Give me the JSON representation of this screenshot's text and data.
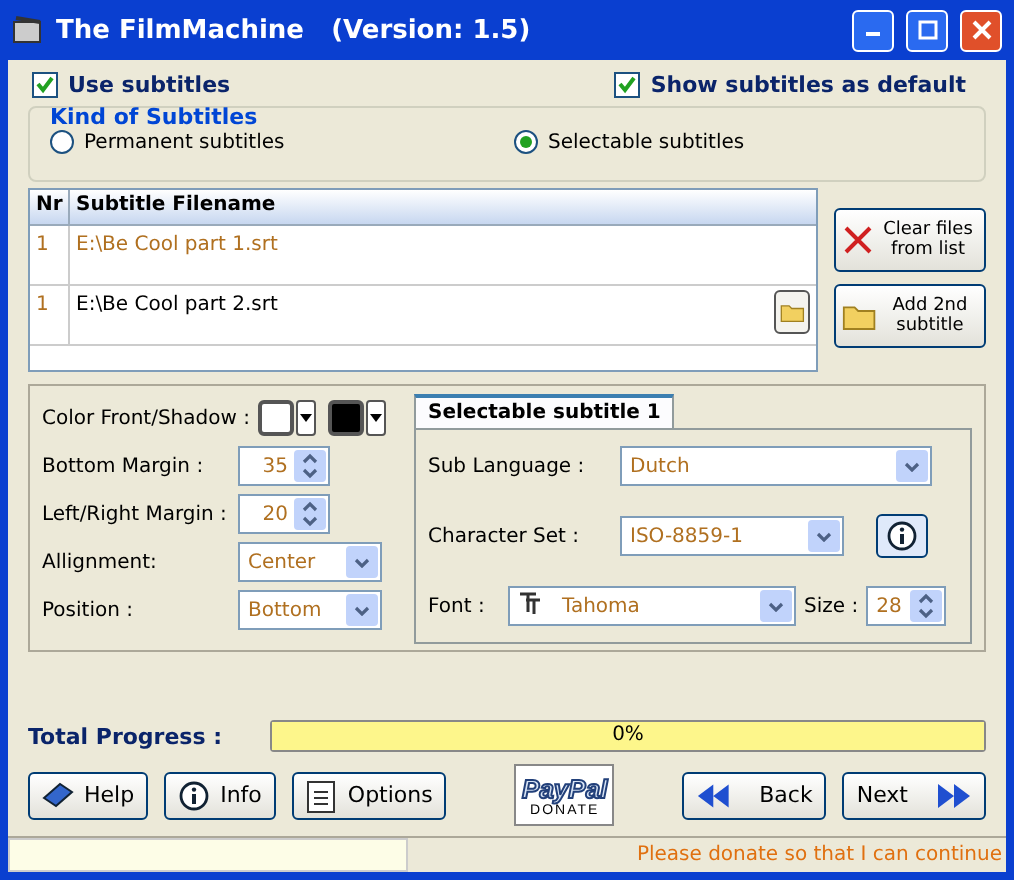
{
  "window": {
    "title": "The FilmMachine   (Version: 1.5)"
  },
  "options": [
    {
      "label": "Use subtitles",
      "checked": true
    },
    {
      "label": "Show subtitles as default",
      "checked": true
    }
  ],
  "kind_group": {
    "title": "Kind of Subtitles",
    "options": [
      {
        "label": "Permanent subtitles",
        "selected": false
      },
      {
        "label": "Selectable subtitles",
        "selected": true
      }
    ]
  },
  "table": {
    "columns": [
      "Nr",
      "Subtitle Filename"
    ],
    "rows": [
      {
        "nr": "1",
        "filename": "E:\\Be Cool part 1.srt",
        "editing": false
      },
      {
        "nr": "1",
        "filename": "E:\\Be Cool part 2.srt",
        "editing": true
      }
    ]
  },
  "side_buttons": [
    {
      "label": "Clear files from list",
      "kind": "clear"
    },
    {
      "label": "Add 2nd subtitle",
      "kind": "add"
    }
  ],
  "style_panel": {
    "color_label": "Color Front/Shadow :",
    "swatches": [
      {
        "color": "#ffffff"
      },
      {
        "color": "#000000"
      }
    ],
    "rows": [
      {
        "label": "Bottom Margin :",
        "value": "35",
        "kind": "spin"
      },
      {
        "label": "Left/Right Margin :",
        "value": "20",
        "kind": "spin"
      },
      {
        "label": "Allignment:",
        "value": "Center",
        "kind": "select"
      },
      {
        "label": "Position :",
        "value": "Bottom",
        "kind": "select"
      }
    ]
  },
  "tab": {
    "title": "Selectable subtitle 1",
    "sub_language": {
      "label": "Sub Language :",
      "value": "Dutch"
    },
    "character_set": {
      "label": "Character Set :",
      "value": "ISO-8859-1"
    },
    "font": {
      "label": "Font :",
      "value": "Tahoma"
    },
    "size": {
      "label": "Size :",
      "value": "28"
    }
  },
  "progress": {
    "label": "Total Progress :",
    "level": 0,
    "text": "0%"
  },
  "buttons": [
    {
      "label": "Help",
      "kind": "help"
    },
    {
      "label": "Info",
      "kind": "info"
    },
    {
      "label": "Options",
      "kind": "options"
    }
  ],
  "donate": {
    "top": "PayPal",
    "bottom": "DONATE"
  },
  "nav_buttons": [
    {
      "label": "Back",
      "kind": "back"
    },
    {
      "label": "Next",
      "kind": "next"
    }
  ],
  "status": {
    "message": "Please donate so that I can continue"
  }
}
